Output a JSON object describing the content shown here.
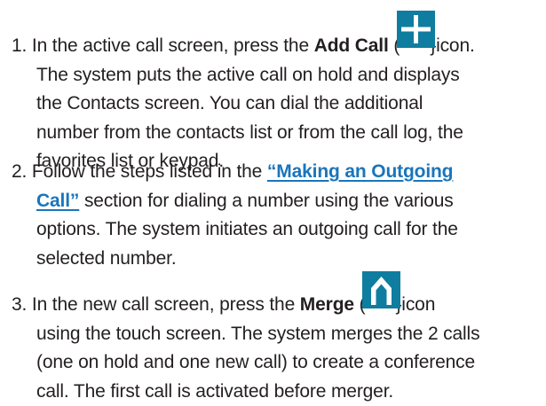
{
  "step1": {
    "prefix": "1. In the active call screen, press the ",
    "button_name": "Add Call",
    "open_paren": " (",
    "icon": "plus-icon",
    "close_suffix": "}icon.",
    "lines": [
      "The system puts the active call on hold and displays",
      "the Contacts screen. You can dial the additional",
      "number from the contacts list or from the call log, the",
      "favorites list or keypad."
    ]
  },
  "step2": {
    "prefix": "2. Follow the steps listed in the ",
    "link_text_line1": "“Making an Outgoing",
    "link_text_line2": "Call”",
    "line2_suffix": " section for dialing a number using the various",
    "lines": [
      "options. The system initiates an outgoing call for the",
      "selected number."
    ]
  },
  "step3": {
    "prefix": "3. In the new call screen, press the ",
    "button_name": "Merge",
    "open_paren": " (",
    "icon": "merge-icon",
    "close_suffix": "}icon",
    "lines": [
      "using the touch screen. The system merges the 2 calls",
      "(one on hold and one new call) to create a conference",
      "call. The first call is activated before merger."
    ]
  },
  "colors": {
    "text": "#231f20",
    "link": "#1a75bb",
    "icon_background": "#0e7d9f",
    "icon_glyph": "#ffffff"
  }
}
